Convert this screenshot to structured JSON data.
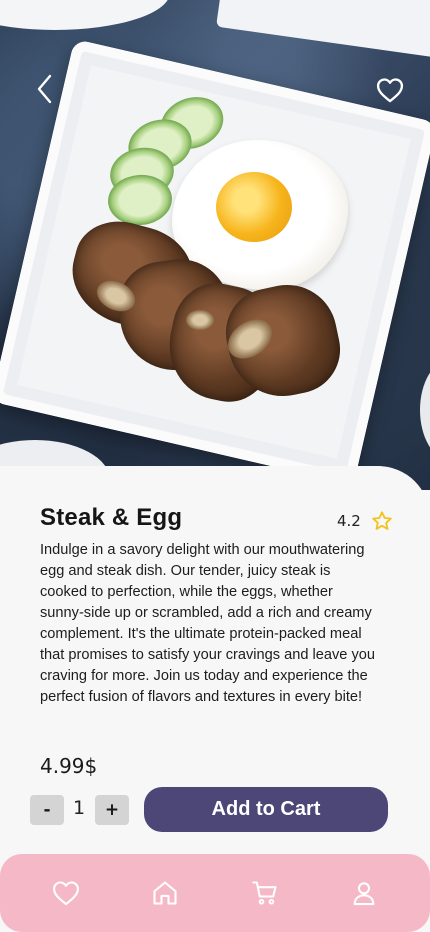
{
  "hero": {
    "back_icon": "chevron-left-icon",
    "favorite_icon": "heart-outline-icon"
  },
  "product": {
    "name": "Steak & Egg",
    "rating": "4.2",
    "rating_icon": "star-outline-icon",
    "description": "Indulge in a savory delight with our mouthwatering egg and steak dish. Our tender, juicy steak is cooked to perfection, while the eggs, whether sunny-side up or scrambled, add a rich and creamy complement. It's the ultimate protein-packed meal that promises to satisfy your cravings and leave you craving for more. Join us today and experience the perfect fusion of flavors and textures in every bite!",
    "price": "4.99$"
  },
  "quantity": {
    "minus_label": "-",
    "value": "1",
    "plus_label": "+"
  },
  "actions": {
    "add_to_cart_label": "Add to Cart"
  },
  "nav": {
    "items": [
      {
        "icon": "heart-icon"
      },
      {
        "icon": "home-icon"
      },
      {
        "icon": "cart-icon"
      },
      {
        "icon": "user-icon"
      }
    ]
  },
  "colors": {
    "primary_button": "#4c4777",
    "nav_background": "#f5b8c7",
    "star": "#f4c21a",
    "stepper_button": "#d4d4d4"
  }
}
